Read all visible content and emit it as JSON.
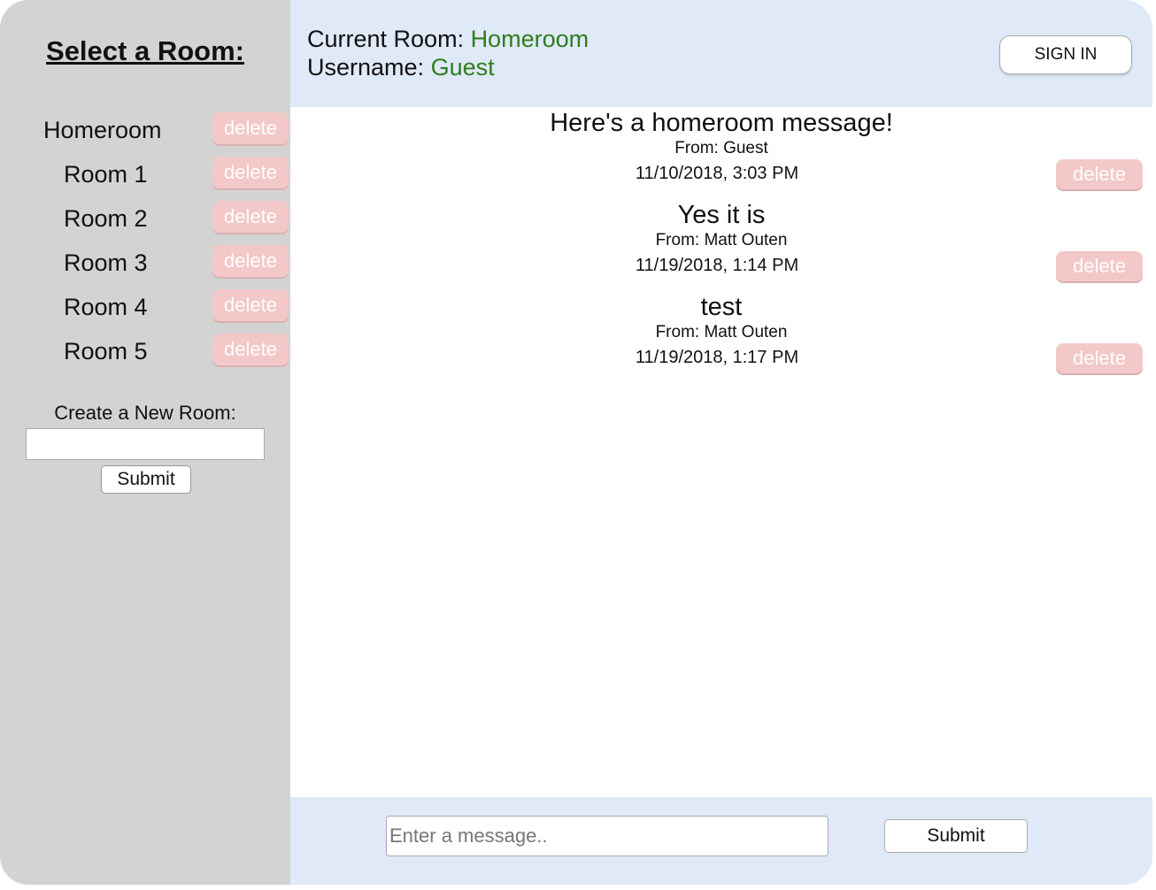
{
  "sidebar": {
    "title": "Select a Room:",
    "rooms": [
      {
        "label": "Homeroom",
        "delete_label": "delete"
      },
      {
        "label": "Room 1",
        "delete_label": "delete"
      },
      {
        "label": "Room 2",
        "delete_label": "delete"
      },
      {
        "label": "Room 3",
        "delete_label": "delete"
      },
      {
        "label": "Room 4",
        "delete_label": "delete"
      },
      {
        "label": "Room 5",
        "delete_label": "delete"
      }
    ],
    "create_label": "Create a New Room:",
    "create_value": "",
    "create_submit": "Submit"
  },
  "header": {
    "room_prefix": "Current Room: ",
    "room_value": "Homeroom",
    "user_prefix": "Username: ",
    "user_value": "Guest",
    "signin_label": "SIGN IN"
  },
  "messages": [
    {
      "text": "Here's a homeroom message!",
      "from": "From: Guest",
      "time": "11/10/2018, 3:03 PM",
      "delete_label": "delete"
    },
    {
      "text": "Yes it is",
      "from": "From: Matt Outen",
      "time": "11/19/2018, 1:14 PM",
      "delete_label": "delete"
    },
    {
      "text": "test",
      "from": "From: Matt Outen",
      "time": "11/19/2018, 1:17 PM",
      "delete_label": "delete"
    }
  ],
  "footer": {
    "placeholder": "Enter a message..",
    "submit_label": "Submit"
  },
  "colors": {
    "sidebar_bg": "#d3d3d3",
    "header_bg": "#e0e9f8",
    "accent_green": "#2e7d1f",
    "delete_bg": "#f3c8c8"
  }
}
